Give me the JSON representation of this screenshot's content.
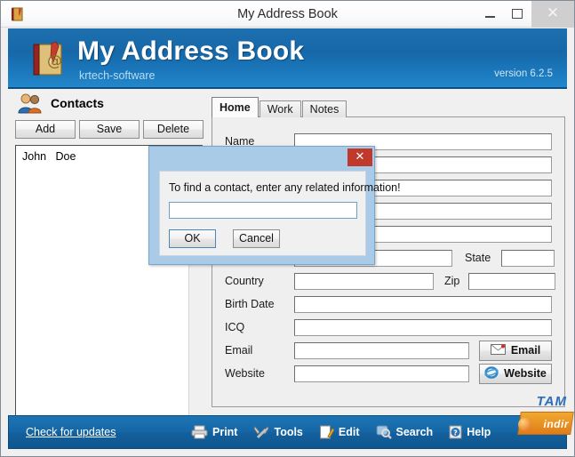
{
  "window": {
    "title": "My Address Book",
    "icon": "address-book-icon",
    "controls": {
      "minimize": "–",
      "maximize": "□",
      "close": "✕"
    }
  },
  "app_header": {
    "title": "My Address Book",
    "subtitle": "krtech-software",
    "version": "version 6.2.5",
    "accent_color": "#1668a8"
  },
  "sidebar": {
    "heading": "Contacts",
    "heading_icon": "people-icon",
    "buttons": [
      {
        "label": "Add",
        "name": "add-button"
      },
      {
        "label": "Save",
        "name": "save-button"
      },
      {
        "label": "Delete",
        "name": "delete-button"
      }
    ],
    "contacts": [
      "John   Doe"
    ],
    "scroll": {
      "up": "▲",
      "down": "▼"
    }
  },
  "tabs": [
    {
      "label": "Home",
      "active": true
    },
    {
      "label": "Work",
      "active": false
    },
    {
      "label": "Notes",
      "active": false
    }
  ],
  "form": {
    "fields": [
      {
        "label": "Name",
        "value": ""
      },
      {
        "label": "",
        "value": ""
      },
      {
        "label": "",
        "value": ""
      },
      {
        "label": "",
        "value": ""
      },
      {
        "label": "",
        "value": ""
      }
    ],
    "state_label": "State",
    "state_value": "",
    "country_label": "Country",
    "country_value": "",
    "zip_label": "Zip",
    "zip_value": "",
    "birth_label": "Birth Date",
    "birth_value": "",
    "icq_label": "ICQ",
    "icq_value": "",
    "email_label": "Email",
    "email_value": "",
    "website_label": "Website",
    "website_value": "",
    "email_button": "Email",
    "website_button": "Website"
  },
  "dialog": {
    "message": "To find a contact, enter any related information!",
    "input_value": "",
    "ok_label": "OK",
    "cancel_label": "Cancel",
    "close_glyph": "✕",
    "titlebar_color": "#a9cbe8",
    "close_color": "#c0392b"
  },
  "bottombar": {
    "updates_link": "Check for updates",
    "items": [
      {
        "label": "Print",
        "icon": "printer-icon"
      },
      {
        "label": "Tools",
        "icon": "wrench-icon"
      },
      {
        "label": "Edit",
        "icon": "edit-icon"
      },
      {
        "label": "Search",
        "icon": "magnifier-icon"
      },
      {
        "label": "Help",
        "icon": "question-icon"
      }
    ]
  },
  "watermark": {
    "top": "TAM",
    "bottom": "indir"
  }
}
